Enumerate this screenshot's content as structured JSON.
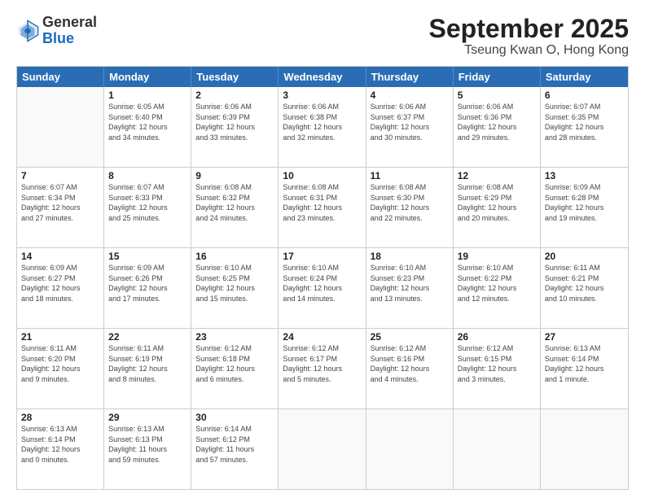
{
  "logo": {
    "general": "General",
    "blue": "Blue"
  },
  "title": "September 2025",
  "location": "Tseung Kwan O, Hong Kong",
  "weekdays": [
    "Sunday",
    "Monday",
    "Tuesday",
    "Wednesday",
    "Thursday",
    "Friday",
    "Saturday"
  ],
  "rows": [
    [
      {
        "day": "",
        "info": ""
      },
      {
        "day": "1",
        "info": "Sunrise: 6:05 AM\nSunset: 6:40 PM\nDaylight: 12 hours\nand 34 minutes."
      },
      {
        "day": "2",
        "info": "Sunrise: 6:06 AM\nSunset: 6:39 PM\nDaylight: 12 hours\nand 33 minutes."
      },
      {
        "day": "3",
        "info": "Sunrise: 6:06 AM\nSunset: 6:38 PM\nDaylight: 12 hours\nand 32 minutes."
      },
      {
        "day": "4",
        "info": "Sunrise: 6:06 AM\nSunset: 6:37 PM\nDaylight: 12 hours\nand 30 minutes."
      },
      {
        "day": "5",
        "info": "Sunrise: 6:06 AM\nSunset: 6:36 PM\nDaylight: 12 hours\nand 29 minutes."
      },
      {
        "day": "6",
        "info": "Sunrise: 6:07 AM\nSunset: 6:35 PM\nDaylight: 12 hours\nand 28 minutes."
      }
    ],
    [
      {
        "day": "7",
        "info": "Sunrise: 6:07 AM\nSunset: 6:34 PM\nDaylight: 12 hours\nand 27 minutes."
      },
      {
        "day": "8",
        "info": "Sunrise: 6:07 AM\nSunset: 6:33 PM\nDaylight: 12 hours\nand 25 minutes."
      },
      {
        "day": "9",
        "info": "Sunrise: 6:08 AM\nSunset: 6:32 PM\nDaylight: 12 hours\nand 24 minutes."
      },
      {
        "day": "10",
        "info": "Sunrise: 6:08 AM\nSunset: 6:31 PM\nDaylight: 12 hours\nand 23 minutes."
      },
      {
        "day": "11",
        "info": "Sunrise: 6:08 AM\nSunset: 6:30 PM\nDaylight: 12 hours\nand 22 minutes."
      },
      {
        "day": "12",
        "info": "Sunrise: 6:08 AM\nSunset: 6:29 PM\nDaylight: 12 hours\nand 20 minutes."
      },
      {
        "day": "13",
        "info": "Sunrise: 6:09 AM\nSunset: 6:28 PM\nDaylight: 12 hours\nand 19 minutes."
      }
    ],
    [
      {
        "day": "14",
        "info": "Sunrise: 6:09 AM\nSunset: 6:27 PM\nDaylight: 12 hours\nand 18 minutes."
      },
      {
        "day": "15",
        "info": "Sunrise: 6:09 AM\nSunset: 6:26 PM\nDaylight: 12 hours\nand 17 minutes."
      },
      {
        "day": "16",
        "info": "Sunrise: 6:10 AM\nSunset: 6:25 PM\nDaylight: 12 hours\nand 15 minutes."
      },
      {
        "day": "17",
        "info": "Sunrise: 6:10 AM\nSunset: 6:24 PM\nDaylight: 12 hours\nand 14 minutes."
      },
      {
        "day": "18",
        "info": "Sunrise: 6:10 AM\nSunset: 6:23 PM\nDaylight: 12 hours\nand 13 minutes."
      },
      {
        "day": "19",
        "info": "Sunrise: 6:10 AM\nSunset: 6:22 PM\nDaylight: 12 hours\nand 12 minutes."
      },
      {
        "day": "20",
        "info": "Sunrise: 6:11 AM\nSunset: 6:21 PM\nDaylight: 12 hours\nand 10 minutes."
      }
    ],
    [
      {
        "day": "21",
        "info": "Sunrise: 6:11 AM\nSunset: 6:20 PM\nDaylight: 12 hours\nand 9 minutes."
      },
      {
        "day": "22",
        "info": "Sunrise: 6:11 AM\nSunset: 6:19 PM\nDaylight: 12 hours\nand 8 minutes."
      },
      {
        "day": "23",
        "info": "Sunrise: 6:12 AM\nSunset: 6:18 PM\nDaylight: 12 hours\nand 6 minutes."
      },
      {
        "day": "24",
        "info": "Sunrise: 6:12 AM\nSunset: 6:17 PM\nDaylight: 12 hours\nand 5 minutes."
      },
      {
        "day": "25",
        "info": "Sunrise: 6:12 AM\nSunset: 6:16 PM\nDaylight: 12 hours\nand 4 minutes."
      },
      {
        "day": "26",
        "info": "Sunrise: 6:12 AM\nSunset: 6:15 PM\nDaylight: 12 hours\nand 3 minutes."
      },
      {
        "day": "27",
        "info": "Sunrise: 6:13 AM\nSunset: 6:14 PM\nDaylight: 12 hours\nand 1 minute."
      }
    ],
    [
      {
        "day": "28",
        "info": "Sunrise: 6:13 AM\nSunset: 6:14 PM\nDaylight: 12 hours\nand 0 minutes."
      },
      {
        "day": "29",
        "info": "Sunrise: 6:13 AM\nSunset: 6:13 PM\nDaylight: 11 hours\nand 59 minutes."
      },
      {
        "day": "30",
        "info": "Sunrise: 6:14 AM\nSunset: 6:12 PM\nDaylight: 11 hours\nand 57 minutes."
      },
      {
        "day": "",
        "info": ""
      },
      {
        "day": "",
        "info": ""
      },
      {
        "day": "",
        "info": ""
      },
      {
        "day": "",
        "info": ""
      }
    ]
  ]
}
